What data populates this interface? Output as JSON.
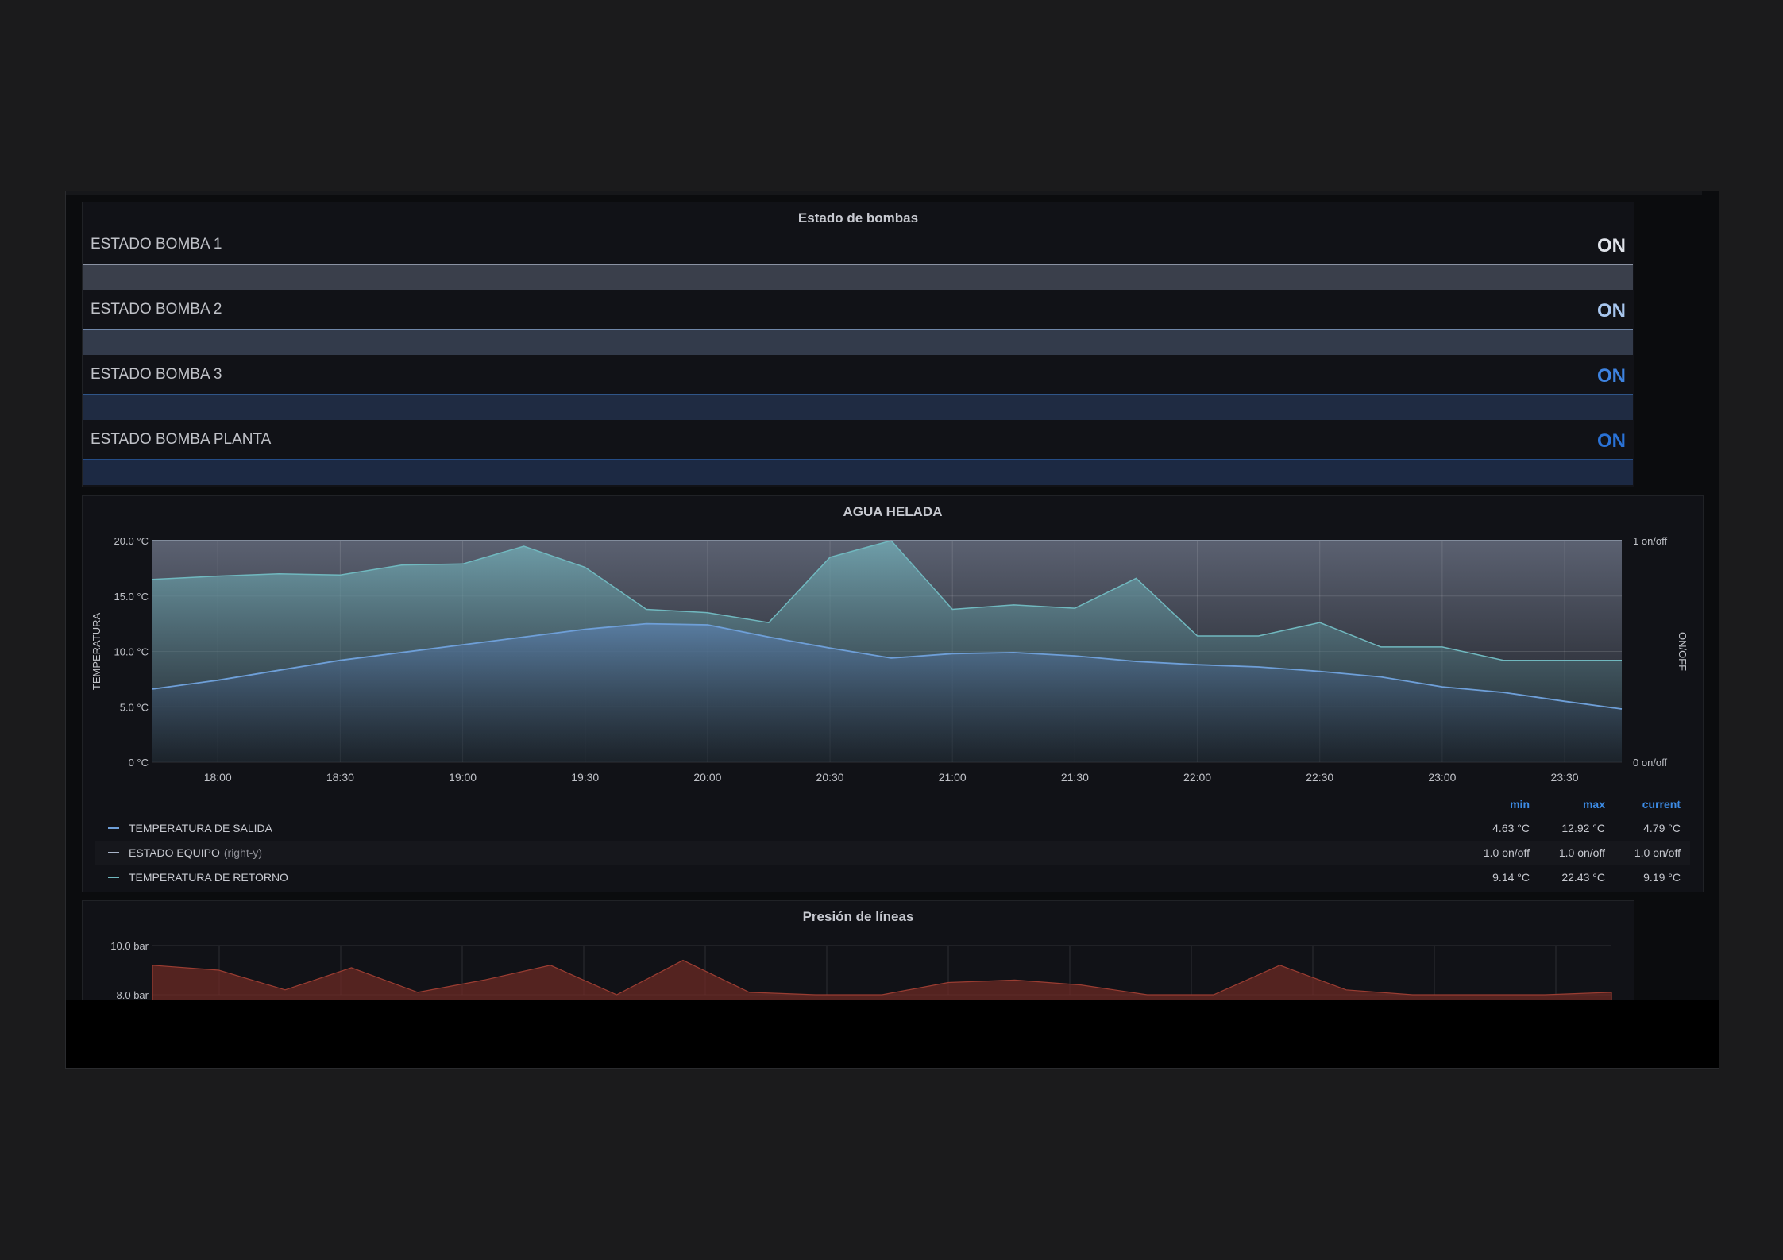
{
  "status_panel": {
    "title": "Estado de bombas",
    "rows": [
      {
        "label": "ESTADO BOMBA 1",
        "value": "ON",
        "value_color": "#e0e3ea",
        "bar_color": "#3a3f4b",
        "line_color": "#8b93a3"
      },
      {
        "label": "ESTADO BOMBA 2",
        "value": "ON",
        "value_color": "#a8c6ee",
        "bar_color": "#333b4b",
        "line_color": "#6f86a8"
      },
      {
        "label": "ESTADO BOMBA 3",
        "value": "ON",
        "value_color": "#3e83e0",
        "bar_color": "#1f2b42",
        "line_color": "#2f5588"
      },
      {
        "label": "ESTADO BOMBA PLANTA",
        "value": "ON",
        "value_color": "#2a72d6",
        "bar_color": "#1c2943",
        "line_color": "#244c86"
      }
    ]
  },
  "agua_panel": {
    "title": "AGUA HELADA",
    "y_left_label": "TEMPERATURA",
    "y_right_label": "ON/OFF",
    "y_left_ticks": [
      "20.0 °C",
      "15.0 °C",
      "10.0 °C",
      "5.0 °C",
      "0 °C"
    ],
    "y_right_ticks": [
      "1 on/off",
      "0 on/off"
    ],
    "x_ticks": [
      "18:00",
      "18:30",
      "19:00",
      "19:30",
      "20:00",
      "20:30",
      "21:00",
      "21:30",
      "22:00",
      "22:30",
      "23:00",
      "23:30"
    ],
    "legend_headers": {
      "min": "min",
      "max": "max",
      "current": "current"
    },
    "legend": [
      {
        "name": "TEMPERATURA DE SALIDA",
        "suffix": "",
        "color": "#6e9fd8",
        "min": "4.63 °C",
        "max": "12.92 °C",
        "current": "4.79 °C"
      },
      {
        "name": "ESTADO EQUIPO",
        "suffix": "(right-y)",
        "color": "#a8b4c8",
        "min": "1.0 on/off",
        "max": "1.0 on/off",
        "current": "1.0 on/off"
      },
      {
        "name": "TEMPERATURA DE RETORNO",
        "suffix": "",
        "color": "#70b8bf",
        "min": "9.14 °C",
        "max": "22.43 °C",
        "current": "9.19 °C"
      }
    ]
  },
  "presion_panel": {
    "title": "Presión de líneas",
    "y_ticks": [
      "10.0 bar",
      "8.0 bar"
    ]
  },
  "chart_data": [
    {
      "type": "line",
      "title": "AGUA HELADA",
      "ylabel": "TEMPERATURA",
      "y2label": "ON/OFF",
      "ylim": [
        0,
        20
      ],
      "y2lim": [
        0,
        1
      ],
      "xlim": [
        "17:44",
        "23:44"
      ],
      "x": [
        "17:44",
        "18:00",
        "18:15",
        "18:30",
        "18:45",
        "19:00",
        "19:15",
        "19:30",
        "19:45",
        "20:00",
        "20:15",
        "20:30",
        "20:45",
        "21:00",
        "21:15",
        "21:30",
        "21:45",
        "22:00",
        "22:15",
        "22:30",
        "22:45",
        "23:00",
        "23:15",
        "23:30",
        "23:44"
      ],
      "series": [
        {
          "name": "TEMPERATURA DE SALIDA",
          "axis": "left",
          "color": "#6e9fd8",
          "values": [
            6.6,
            7.4,
            8.3,
            9.2,
            9.9,
            10.6,
            11.3,
            12.0,
            12.5,
            12.4,
            11.3,
            10.3,
            9.4,
            9.8,
            9.9,
            9.6,
            9.1,
            8.8,
            8.6,
            8.2,
            7.7,
            6.8,
            6.3,
            5.5,
            4.8
          ]
        },
        {
          "name": "ESTADO EQUIPO",
          "axis": "right",
          "color": "#a8b4c8",
          "values": [
            1,
            1,
            1,
            1,
            1,
            1,
            1,
            1,
            1,
            1,
            1,
            1,
            1,
            1,
            1,
            1,
            1,
            1,
            1,
            1,
            1,
            1,
            1,
            1,
            1
          ]
        },
        {
          "name": "TEMPERATURA DE RETORNO",
          "axis": "left",
          "color": "#70b8bf",
          "values": [
            16.5,
            16.8,
            17.0,
            16.9,
            17.8,
            17.9,
            19.5,
            17.6,
            13.8,
            13.5,
            12.6,
            18.5,
            20.0,
            13.8,
            14.2,
            13.9,
            16.6,
            11.4,
            11.4,
            12.6,
            10.4,
            10.4,
            9.2,
            9.2,
            9.2
          ]
        }
      ]
    },
    {
      "type": "area",
      "title": "Presión de líneas",
      "ylim": [
        8,
        10
      ],
      "series": [
        {
          "name": "",
          "color": "#8e3a30",
          "values": [
            9.2,
            9.0,
            8.2,
            9.1,
            8.1,
            8.6,
            9.2,
            8.0,
            9.4,
            8.1,
            8.0,
            8.0,
            8.5,
            8.6,
            8.4,
            8.0,
            8.0,
            9.2,
            8.2,
            8.0,
            8.0,
            8.0,
            8.1
          ]
        }
      ]
    }
  ]
}
